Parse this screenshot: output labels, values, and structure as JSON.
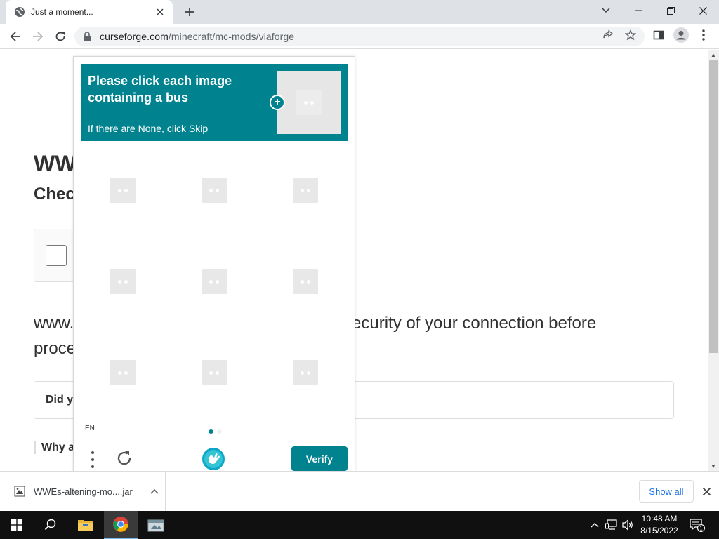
{
  "browser": {
    "tab": {
      "title": "Just a moment...",
      "favicon": "globe-icon"
    },
    "address": {
      "domain": "curseforge.com",
      "path": "/minecraft/mc-mods/viaforge"
    }
  },
  "page": {
    "heading": "WW",
    "subheading": "Chec",
    "body_left_line1": "www.",
    "body_left_line2": "proce",
    "body_right_line1": "ecurity of your connection before",
    "did_you": "Did yo",
    "why": "Why a"
  },
  "captcha": {
    "prompt": "Please click each image containing a bus",
    "hint": "If there are None, click Skip",
    "language": "EN",
    "verify_label": "Verify",
    "accent_color": "#00838f",
    "grid_cells": 9,
    "current_page": 1,
    "total_pages": 2
  },
  "downloads": {
    "file_name": "WWEs-altening-mo....jar",
    "show_all_label": "Show all"
  },
  "taskbar": {
    "time": "10:48 AM",
    "date": "8/15/2022",
    "notifications": "1"
  }
}
